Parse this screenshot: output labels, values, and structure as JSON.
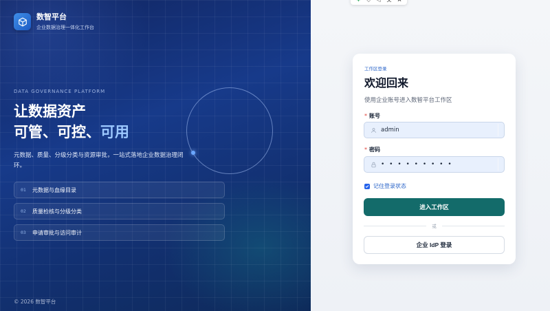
{
  "brand": {
    "name": "数智平台",
    "subtitle": "企业数据治理一体化工作台",
    "logo_icon": "cube-icon"
  },
  "hero": {
    "eyebrow": "DATA GOVERNANCE PLATFORM",
    "headline_line1": "让数据资产",
    "headline_line2_prefix": "可管、可控、",
    "headline_line2_accent": "可用",
    "description": "元数据、质量、分级分类与资源审批，一站式落地企业数据治理闭环。",
    "features": [
      {
        "num": "01",
        "label": "元数据与血缘目录"
      },
      {
        "num": "02",
        "label": "质量检核与分级分类"
      },
      {
        "num": "03",
        "label": "申请审批与访问审计"
      }
    ],
    "copyright": "© 2026 数智平台"
  },
  "login": {
    "tag": "工作区登录",
    "title": "欢迎回来",
    "subtitle": "使用企业账号进入数智平台工作区",
    "account_label": "账号",
    "account_value": "admin",
    "password_label": "密码",
    "password_value": "• • • • • • • • •",
    "required_mark": "*",
    "remember_label": "记住登录状态",
    "remember_checked": true,
    "submit_label": "进入工作区",
    "divider_text": "或",
    "sso_label": "企业 IdP 登录"
  },
  "colors": {
    "primary_button": "#136b6a",
    "accent_blue": "#2563eb",
    "hero_accent": "#9cc8ff"
  }
}
